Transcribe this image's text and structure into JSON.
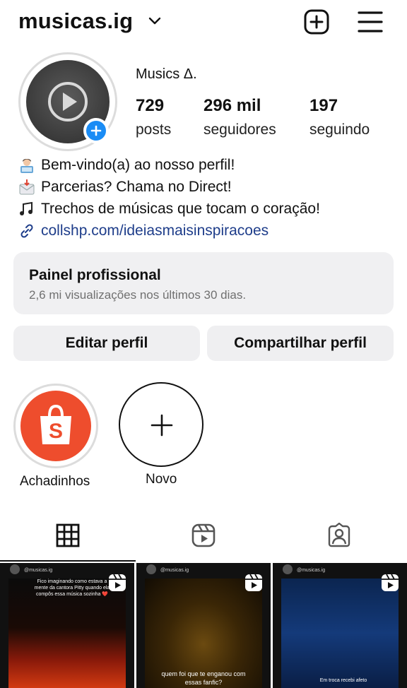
{
  "header": {
    "username": "musicas.ig",
    "chevron_icon": "chevron-down-icon",
    "new_post_icon": "plus-square-icon",
    "menu_icon": "hamburger-menu-icon"
  },
  "profile": {
    "display_name": "Musics Δ.",
    "stats": {
      "posts": {
        "value": "729",
        "label": "posts"
      },
      "followers": {
        "value": "296 mil",
        "label": "seguidores"
      },
      "following": {
        "value": "197",
        "label": "seguindo"
      }
    },
    "bio": [
      {
        "icon": "person-at-laptop-emoji",
        "text": "Bem-vindo(a) ao nosso perfil!"
      },
      {
        "icon": "inbox-envelope-emoji",
        "text": "Parcerias? Chama no Direct!"
      },
      {
        "icon": "music-notes-emoji",
        "text": "Trechos de músicas que tocam o coração!"
      }
    ],
    "link": {
      "icon": "link-icon",
      "text": "collshp.com/ideiasmaisinspiracoes"
    }
  },
  "dashboard": {
    "title": "Painel profissional",
    "subtitle": "2,6 mi visualizações nos últimos 30 dias."
  },
  "buttons": {
    "edit": "Editar perfil",
    "share": "Compartilhar perfil"
  },
  "highlights": [
    {
      "label": "Achadinhos",
      "icon": "shopping-bag-icon"
    },
    {
      "label": "Novo",
      "icon": "plus-icon"
    }
  ],
  "tabs": [
    {
      "name": "grid",
      "icon": "grid-icon",
      "active": true
    },
    {
      "name": "reels",
      "icon": "reels-icon",
      "active": false
    },
    {
      "name": "tagged",
      "icon": "tagged-person-icon",
      "active": false
    }
  ],
  "posts": [
    {
      "handle": "@musicas.ig",
      "caption": "Fico imaginando como estava a mente da cantora Pitty quando ela compôs essa música sozinha ❤️"
    },
    {
      "handle": "@musicas.ig",
      "caption": "quem foi que te enganou com essas fanfic?"
    },
    {
      "handle": "@musicas.ig",
      "caption": "Em troca recebi afeto"
    }
  ],
  "colors": {
    "accent_blue": "#1a8cf5",
    "link": "#1e3d8a",
    "highlight_bg": "#ee4d2d",
    "button_bg": "#efeff1"
  }
}
